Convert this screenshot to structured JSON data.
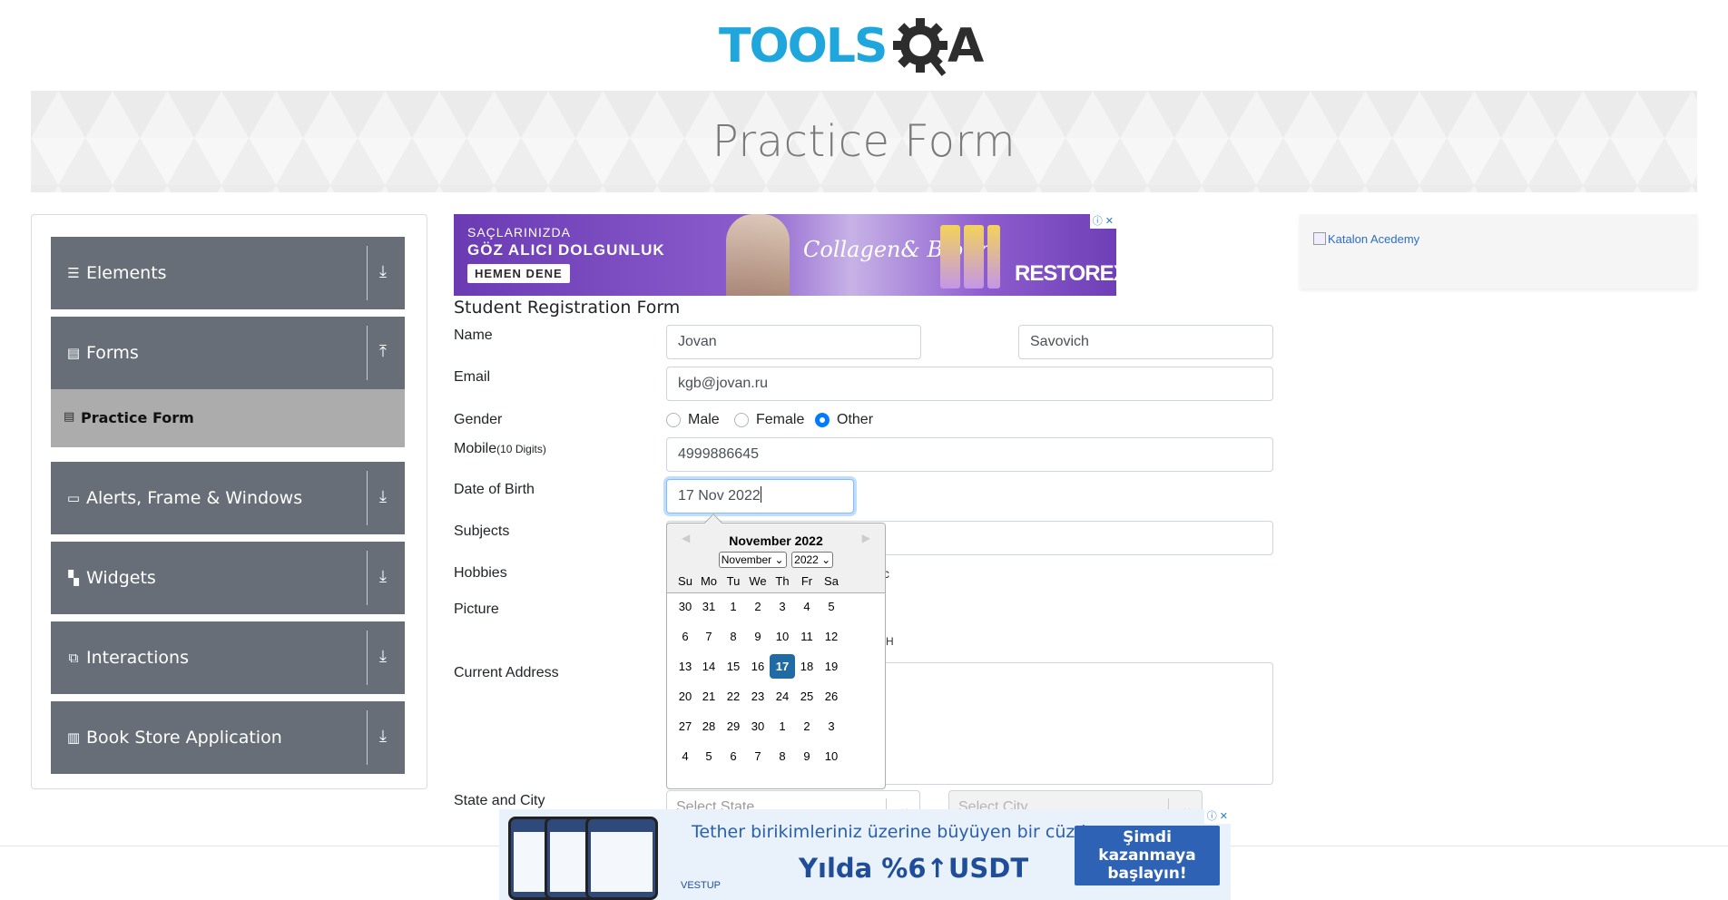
{
  "logo": {
    "text": "TOOLSQA"
  },
  "banner": {
    "title": "Practice Form"
  },
  "sidebar": {
    "groups": [
      {
        "label": "Elements",
        "icon": "hamburger-icon",
        "arrow": "download-icon"
      },
      {
        "label": "Forms",
        "icon": "document-icon",
        "arrow": "upload-icon"
      },
      {
        "label": "Alerts, Frame & Windows",
        "icon": "window-icon",
        "arrow": "download-icon"
      },
      {
        "label": "Widgets",
        "icon": "grid-icon",
        "arrow": "download-icon"
      },
      {
        "label": "Interactions",
        "icon": "interaction-icon",
        "arrow": "download-icon"
      },
      {
        "label": "Book Store Application",
        "icon": "books-icon",
        "arrow": "download-icon"
      }
    ],
    "active_item": "Practice Form"
  },
  "top_ad": {
    "line1": "SAÇLARINIZDA",
    "line2": "GÖZ ALICI DOLGUNLUK",
    "cta": "HEMEN DENE",
    "script": "Collagen& Biotin",
    "brand": "RESTOREX"
  },
  "right_ad": {
    "alt": "Katalon Acedemy"
  },
  "form": {
    "title": "Student Registration Form",
    "name_label": "Name",
    "first_name": "Jovan",
    "last_name": "Savovich",
    "email_label": "Email",
    "email": "kgb@jovan.ru",
    "gender_label": "Gender",
    "genders": [
      "Male",
      "Female",
      "Other"
    ],
    "gender_selected": "Other",
    "mobile_label": "Mobile",
    "mobile_hint": "(10 Digits)",
    "mobile": "4999886645",
    "dob_label": "Date of Birth",
    "dob": "17 Nov 2022",
    "subjects_label": "Subjects",
    "hobbies_label": "Hobbies",
    "picture_label": "Picture",
    "address_label": "Current Address",
    "state_city_label": "State and City",
    "state_placeholder": "Select State",
    "city_placeholder": "Select City",
    "hobby_partial": "c",
    "picture_partial": "H"
  },
  "datepicker": {
    "title": "November 2022",
    "month_select": "November",
    "year_select": "2022",
    "day_names": [
      "Su",
      "Mo",
      "Tu",
      "We",
      "Th",
      "Fr",
      "Sa"
    ],
    "weeks": [
      [
        "30",
        "31",
        "1",
        "2",
        "3",
        "4",
        "5"
      ],
      [
        "6",
        "7",
        "8",
        "9",
        "10",
        "11",
        "12"
      ],
      [
        "13",
        "14",
        "15",
        "16",
        "17",
        "18",
        "19"
      ],
      [
        "20",
        "21",
        "22",
        "23",
        "24",
        "25",
        "26"
      ],
      [
        "27",
        "28",
        "29",
        "30",
        "1",
        "2",
        "3"
      ],
      [
        "4",
        "5",
        "6",
        "7",
        "8",
        "9",
        "10"
      ]
    ],
    "selected_day": "17"
  },
  "bottom_ad": {
    "headline": "Tether birikimleriniz üzerine büyüyen bir cüzdan",
    "rate": "Yılda %6↑USDT",
    "brand": "VESTUP",
    "cta": "Şimdi kazanmaya başlayın!"
  },
  "colors": {
    "sidebar_group": "#676e78",
    "active_item": "#acacac",
    "selected_day": "#216ba5",
    "radio_on": "#007bff",
    "logo_blue": "#1fa6dc",
    "logo_dark": "#2d2d2d"
  }
}
